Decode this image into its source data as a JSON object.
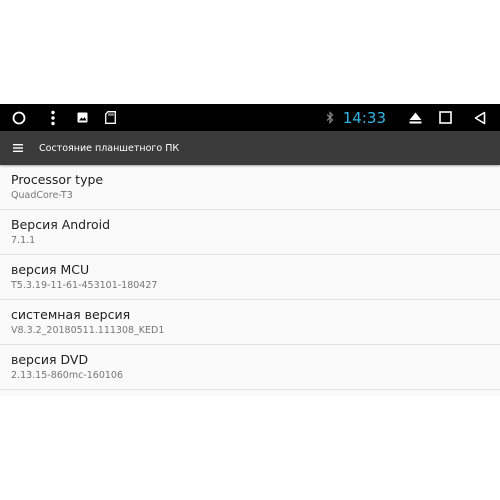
{
  "status_bar": {
    "time": "14:33",
    "icons": [
      "circle-home-icon",
      "vertical-dots-icon",
      "image-icon",
      "sd-card-icon",
      "bluetooth-icon",
      "eject-icon",
      "square-recents-icon",
      "triangle-back-icon"
    ],
    "time_color": "#33b5e5"
  },
  "app_bar": {
    "title": "Состояние планшетного ПК",
    "menu_icon": "menu-icon"
  },
  "items": [
    {
      "title": "Processor type",
      "value": "QuadCore-T3"
    },
    {
      "title": "Версия Android",
      "value": "7.1.1"
    },
    {
      "title": "версия MCU",
      "value": "T5.3.19-11-61-453101-180427"
    },
    {
      "title": "системная версия",
      "value": "V8.3.2_20180511.111308_KED1"
    },
    {
      "title": "версия DVD",
      "value": "2.13.15-860mc-160106"
    }
  ]
}
